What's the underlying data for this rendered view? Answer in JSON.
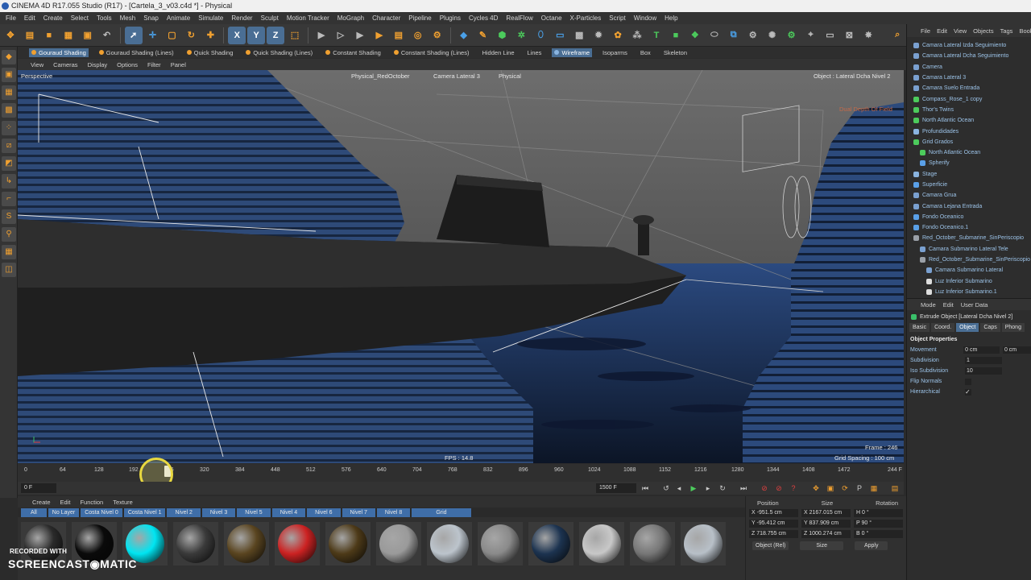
{
  "window": {
    "title": "CINEMA 4D R17.055 Studio (R17) - [Cartela_3_v03.c4d *] - Physical"
  },
  "menu": [
    "File",
    "Edit",
    "Create",
    "Select",
    "Tools",
    "Mesh",
    "Snap",
    "Animate",
    "Simulate",
    "Render",
    "Sculpt",
    "Motion Tracker",
    "MoGraph",
    "Character",
    "Pipeline",
    "Plugins",
    "Cycles 4D",
    "RealFlow",
    "Octane",
    "X-Particles",
    "Script",
    "Window",
    "Help"
  ],
  "toolbar": {
    "axis_x": "X",
    "axis_y": "Y",
    "axis_z": "Z"
  },
  "shading": [
    "Gouraud Shading",
    "Gouraud Shading (Lines)",
    "Quick Shading",
    "Quick Shading (Lines)",
    "Constant Shading",
    "Constant Shading (Lines)",
    "Hidden Line",
    "Lines",
    "Wireframe",
    "Isoparms",
    "Box",
    "Skeleton"
  ],
  "view_menu": [
    "View",
    "Cameras",
    "Display",
    "Options",
    "Filter",
    "Panel"
  ],
  "viewport": {
    "mode": "Perspective",
    "camera1": "Physical_RedOctober",
    "camera2": "Camera Lateral 3",
    "camera3": "Physical",
    "object_label": "Object : Lateral Dcha Nivel 2",
    "dof_label": "Dual Depth Of Field",
    "fps": "FPS : 14.8",
    "frame": "Frame : 246",
    "grid_spacing": "Grid Spacing : 100 cm"
  },
  "timeline": {
    "ticks": [
      "0",
      "64",
      "128",
      "192",
      "256",
      "320",
      "384",
      "448",
      "512",
      "576",
      "640",
      "704",
      "768",
      "832",
      "896",
      "960",
      "1024",
      "1088",
      "1152",
      "1216",
      "1280",
      "1344",
      "1408",
      "1472"
    ],
    "end_marker": "244 F",
    "current_frame_fraction": 0.164
  },
  "transport": {
    "start_field": "0 F",
    "end_field": "1500 F"
  },
  "materials": {
    "menu": [
      "Create",
      "Edit",
      "Function",
      "Texture"
    ],
    "layers": [
      "All",
      "No Layer",
      "Costa Nivel 0",
      "Costa Nivel 1",
      "Nivel 2",
      "Nivel 3",
      "Nivel 5",
      "Nivel 4",
      "Nivel 6",
      "Nivel 7",
      "Nivel 8",
      "Grid"
    ],
    "swatch_colors": [
      "#2a2a2a",
      "#0a0a0a",
      "#00e5f2",
      "#3a3a3a",
      "#5a4520",
      "#cc2222",
      "#4d3a18",
      "#9a9a9a",
      "#bcc4cc",
      "#8a8a8a",
      "#1c3350",
      "#c8c8c8",
      "#777777",
      "#b8c0c8"
    ]
  },
  "coords": {
    "headers": [
      "Position",
      "Size",
      "Rotation"
    ],
    "rows": [
      {
        "pos": "X  -951.5 cm",
        "size": "X  2167.015 cm",
        "rot": "H  0 °"
      },
      {
        "pos": "Y  -95.412 cm",
        "size": "Y  837.909 cm",
        "rot": "P  90 °"
      },
      {
        "pos": "Z  718.755 cm",
        "size": "Z  1000.274 cm",
        "rot": "B  0 °"
      }
    ],
    "mode": "Object (Rel)",
    "size_mode": "Size",
    "apply": "Apply"
  },
  "object_manager": {
    "menu": [
      "File",
      "Edit",
      "View",
      "Objects",
      "Tags",
      "Bookmarks"
    ],
    "items": [
      "Camara Lateral Izda Seguimiento",
      "Camara Lateral Dcha Seguimiento",
      "Camera",
      "Camara Lateral 3",
      "Camara Suelo Entrada",
      "Compass_Rose_1 copy",
      "Thor's Twins",
      "North Atlantic Ocean",
      "Profundidades",
      "Grid Grados",
      "North Atlantic Ocean",
      "Spherify",
      "Stage",
      "Superficie",
      "Camara Grua",
      "Camara Lejana Entrada",
      "Fondo Oceanico",
      "Fondo Oceanico.1",
      "Red_October_Submarine_SinPeriscopio",
      "Camara Submarino Lateral Tele",
      "Red_October_Submarine_SinPeriscopio",
      "Camara Submarino Lateral",
      "Luz Inferior Submarino",
      "Luz Inferior Submarino.1"
    ]
  },
  "attributes": {
    "menu": [
      "Mode",
      "Edit",
      "User Data"
    ],
    "title": "Extrude Object [Lateral Dcha Nivel 2]",
    "tabs": [
      "Basic",
      "Coord.",
      "Object",
      "Caps",
      "Phong"
    ],
    "section": "Object Properties",
    "movement_label": "Movement",
    "movement_values": [
      "0 cm",
      "0 cm",
      "0 cm"
    ],
    "subdivision_label": "Subdivision",
    "subdivision_value": "1",
    "iso_label": "Iso Subdivision",
    "iso_value": "10",
    "flip_label": "Flip Normals",
    "hier_label": "Hierarchical",
    "hier_check": "✓"
  },
  "watermark": {
    "recorded": "RECORDED WITH",
    "brand": "SCREENCAST◉MATIC"
  }
}
